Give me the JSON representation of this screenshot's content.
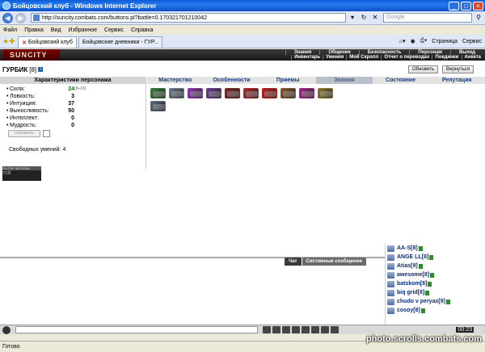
{
  "window": {
    "title": "Бойцовский клуб - Windows Internet Explorer"
  },
  "address": {
    "url": "http://suncity.combats.com/buttons.pl?battle=0.170321701210042",
    "search_placeholder": "Google"
  },
  "menu": [
    "Файл",
    "Правка",
    "Вид",
    "Избранное",
    "Сервис",
    "Справка"
  ],
  "tabs": [
    {
      "label": "Бойцовский клуб",
      "active": true
    },
    {
      "label": "Бойцовские дневники - ГУР...",
      "active": false
    }
  ],
  "tab_tools": {
    "page": "Страница",
    "service": "Сервис"
  },
  "site": {
    "logo": "SUNCITY",
    "top_menu_1": [
      "Знания",
      "Общение",
      "Безопасность",
      "Персонаж",
      "Выход"
    ],
    "top_menu_2": [
      "Инвентарь",
      "Умения",
      "Мой Скролл",
      "Отчет о переводах",
      "Поединки",
      "Анкета"
    ]
  },
  "character": {
    "name": "ГУРБИК",
    "level": "[8]",
    "refresh": "Обновить",
    "back": "Вернуться"
  },
  "stats_header": "Характеристики персонажа",
  "skill_tabs": [
    {
      "label": "Мастерство",
      "selected": false
    },
    {
      "label": "Особенности",
      "selected": false
    },
    {
      "label": "Приемы",
      "selected": false
    },
    {
      "label": "Знания",
      "selected": true
    },
    {
      "label": "Состояние",
      "selected": false
    },
    {
      "label": "Репутация",
      "selected": false
    }
  ],
  "stats": [
    {
      "label": "Сила:",
      "value": "24",
      "bonus": "(8+16)",
      "green": true
    },
    {
      "label": "Ловкость:",
      "value": "3"
    },
    {
      "label": "Интуиция:",
      "value": "37"
    },
    {
      "label": "Выносливость:",
      "value": "50"
    },
    {
      "label": "Интеллект:",
      "value": "0"
    },
    {
      "label": "Мудрость:",
      "value": "0"
    }
  ],
  "save_label": "сохранить",
  "free_skills": "Свободных умений: 4",
  "counter": {
    "top": "RUTOP 96379368",
    "bottom": "rcit"
  },
  "items": [
    {
      "color": "#3c7a3c"
    },
    {
      "color": "#6a7a8a"
    },
    {
      "color": "#8a3aa8"
    },
    {
      "color": "#6a3c8a"
    },
    {
      "color": "#7a2a2a"
    },
    {
      "color": "#b02a2a"
    },
    {
      "color": "#c02020"
    },
    {
      "color": "#8a5a2a"
    },
    {
      "color": "#a02a8a"
    },
    {
      "color": "#8a7a2a"
    },
    {
      "color": "#5a6a7a"
    }
  ],
  "chat": {
    "tab_chat": "Чат",
    "tab_system": "Системные сообщения"
  },
  "users": [
    {
      "name": "АА-S",
      "level": "[8]"
    },
    {
      "name": "ANGE LL",
      "level": "[8]"
    },
    {
      "name": "Atias",
      "level": "[9]"
    },
    {
      "name": "awesome",
      "level": "[8]"
    },
    {
      "name": "batskom",
      "level": "[8]"
    },
    {
      "name": "biq grid",
      "level": "[8]"
    },
    {
      "name": "chudo v peryax",
      "level": "[9]"
    },
    {
      "name": "cosoy",
      "level": "[8]"
    }
  ],
  "clock": "00:23",
  "status": "Готово",
  "watermark": "photo.scrolls.combats.com"
}
